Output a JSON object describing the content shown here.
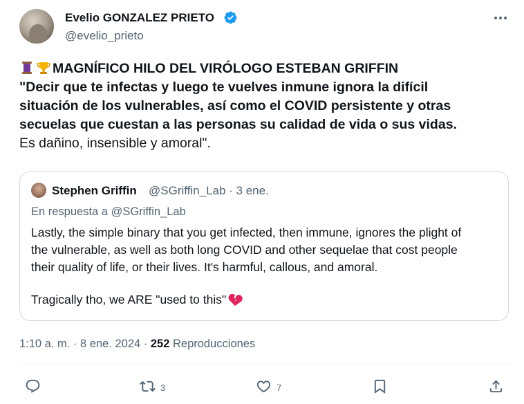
{
  "author": {
    "name": "Evelio GONZALEZ PRIETO",
    "handle": "@evelio_prieto"
  },
  "tweet": {
    "headline": "MAGNÍFICO HILO DEL VIRÓLOGO ESTEBAN GRIFFIN",
    "bold_lines": [
      "\"Decir que te infectas y luego te vuelves inmune ignora la difícil",
      "situación de los vulnerables, así como el COVID persistente y otras",
      "secuelas que cuestan a las personas su calidad de vida o sus vidas."
    ],
    "last_line": "Es dañino, insensible y amoral\".",
    "leading_icons": [
      "thread-spool-icon",
      "trophy-icon"
    ]
  },
  "quote": {
    "name": "Stephen Griffin",
    "handle_date": "@SGriffin_Lab · 3 ene.",
    "reply_to": "En respuesta a @SGriffin_Lab",
    "lines": [
      "Lastly, the simple binary that you get infected, then immune, ignores the plight of",
      "the vulnerable, as well as both long COVID and other sequelae that cost people",
      "their quality of life, or their lives. It's harmful, callous, and amoral."
    ],
    "last_line": "Tragically tho, we ARE \"used to this\"",
    "trailing_icon": "broken-heart-icon"
  },
  "meta": {
    "datetime": "1:10 a. m. · 8 ene. 2024 · ",
    "views": "252",
    "views_label": " Reproducciones"
  },
  "actions": {
    "reply_count": "",
    "retweet_count": "3",
    "like_count": "7"
  },
  "colors": {
    "verified": "#1d9bf0",
    "secondary_text": "#536471",
    "border": "#cfd9de",
    "broken_heart": "#e0245e"
  }
}
